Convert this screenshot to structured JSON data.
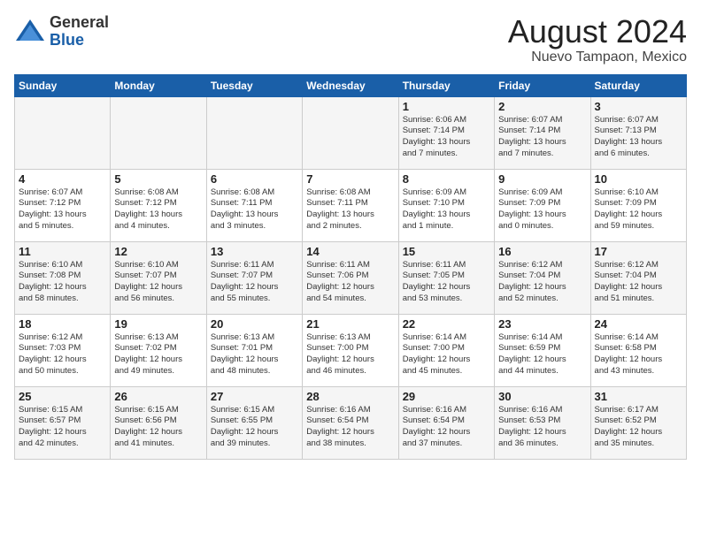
{
  "header": {
    "logo_general": "General",
    "logo_blue": "Blue",
    "month_title": "August 2024",
    "location": "Nuevo Tampaon, Mexico"
  },
  "weekdays": [
    "Sunday",
    "Monday",
    "Tuesday",
    "Wednesday",
    "Thursday",
    "Friday",
    "Saturday"
  ],
  "weeks": [
    [
      {
        "day": "",
        "info": ""
      },
      {
        "day": "",
        "info": ""
      },
      {
        "day": "",
        "info": ""
      },
      {
        "day": "",
        "info": ""
      },
      {
        "day": "1",
        "info": "Sunrise: 6:06 AM\nSunset: 7:14 PM\nDaylight: 13 hours\nand 7 minutes."
      },
      {
        "day": "2",
        "info": "Sunrise: 6:07 AM\nSunset: 7:14 PM\nDaylight: 13 hours\nand 7 minutes."
      },
      {
        "day": "3",
        "info": "Sunrise: 6:07 AM\nSunset: 7:13 PM\nDaylight: 13 hours\nand 6 minutes."
      }
    ],
    [
      {
        "day": "4",
        "info": "Sunrise: 6:07 AM\nSunset: 7:12 PM\nDaylight: 13 hours\nand 5 minutes."
      },
      {
        "day": "5",
        "info": "Sunrise: 6:08 AM\nSunset: 7:12 PM\nDaylight: 13 hours\nand 4 minutes."
      },
      {
        "day": "6",
        "info": "Sunrise: 6:08 AM\nSunset: 7:11 PM\nDaylight: 13 hours\nand 3 minutes."
      },
      {
        "day": "7",
        "info": "Sunrise: 6:08 AM\nSunset: 7:11 PM\nDaylight: 13 hours\nand 2 minutes."
      },
      {
        "day": "8",
        "info": "Sunrise: 6:09 AM\nSunset: 7:10 PM\nDaylight: 13 hours\nand 1 minute."
      },
      {
        "day": "9",
        "info": "Sunrise: 6:09 AM\nSunset: 7:09 PM\nDaylight: 13 hours\nand 0 minutes."
      },
      {
        "day": "10",
        "info": "Sunrise: 6:10 AM\nSunset: 7:09 PM\nDaylight: 12 hours\nand 59 minutes."
      }
    ],
    [
      {
        "day": "11",
        "info": "Sunrise: 6:10 AM\nSunset: 7:08 PM\nDaylight: 12 hours\nand 58 minutes."
      },
      {
        "day": "12",
        "info": "Sunrise: 6:10 AM\nSunset: 7:07 PM\nDaylight: 12 hours\nand 56 minutes."
      },
      {
        "day": "13",
        "info": "Sunrise: 6:11 AM\nSunset: 7:07 PM\nDaylight: 12 hours\nand 55 minutes."
      },
      {
        "day": "14",
        "info": "Sunrise: 6:11 AM\nSunset: 7:06 PM\nDaylight: 12 hours\nand 54 minutes."
      },
      {
        "day": "15",
        "info": "Sunrise: 6:11 AM\nSunset: 7:05 PM\nDaylight: 12 hours\nand 53 minutes."
      },
      {
        "day": "16",
        "info": "Sunrise: 6:12 AM\nSunset: 7:04 PM\nDaylight: 12 hours\nand 52 minutes."
      },
      {
        "day": "17",
        "info": "Sunrise: 6:12 AM\nSunset: 7:04 PM\nDaylight: 12 hours\nand 51 minutes."
      }
    ],
    [
      {
        "day": "18",
        "info": "Sunrise: 6:12 AM\nSunset: 7:03 PM\nDaylight: 12 hours\nand 50 minutes."
      },
      {
        "day": "19",
        "info": "Sunrise: 6:13 AM\nSunset: 7:02 PM\nDaylight: 12 hours\nand 49 minutes."
      },
      {
        "day": "20",
        "info": "Sunrise: 6:13 AM\nSunset: 7:01 PM\nDaylight: 12 hours\nand 48 minutes."
      },
      {
        "day": "21",
        "info": "Sunrise: 6:13 AM\nSunset: 7:00 PM\nDaylight: 12 hours\nand 46 minutes."
      },
      {
        "day": "22",
        "info": "Sunrise: 6:14 AM\nSunset: 7:00 PM\nDaylight: 12 hours\nand 45 minutes."
      },
      {
        "day": "23",
        "info": "Sunrise: 6:14 AM\nSunset: 6:59 PM\nDaylight: 12 hours\nand 44 minutes."
      },
      {
        "day": "24",
        "info": "Sunrise: 6:14 AM\nSunset: 6:58 PM\nDaylight: 12 hours\nand 43 minutes."
      }
    ],
    [
      {
        "day": "25",
        "info": "Sunrise: 6:15 AM\nSunset: 6:57 PM\nDaylight: 12 hours\nand 42 minutes."
      },
      {
        "day": "26",
        "info": "Sunrise: 6:15 AM\nSunset: 6:56 PM\nDaylight: 12 hours\nand 41 minutes."
      },
      {
        "day": "27",
        "info": "Sunrise: 6:15 AM\nSunset: 6:55 PM\nDaylight: 12 hours\nand 39 minutes."
      },
      {
        "day": "28",
        "info": "Sunrise: 6:16 AM\nSunset: 6:54 PM\nDaylight: 12 hours\nand 38 minutes."
      },
      {
        "day": "29",
        "info": "Sunrise: 6:16 AM\nSunset: 6:54 PM\nDaylight: 12 hours\nand 37 minutes."
      },
      {
        "day": "30",
        "info": "Sunrise: 6:16 AM\nSunset: 6:53 PM\nDaylight: 12 hours\nand 36 minutes."
      },
      {
        "day": "31",
        "info": "Sunrise: 6:17 AM\nSunset: 6:52 PM\nDaylight: 12 hours\nand 35 minutes."
      }
    ]
  ]
}
